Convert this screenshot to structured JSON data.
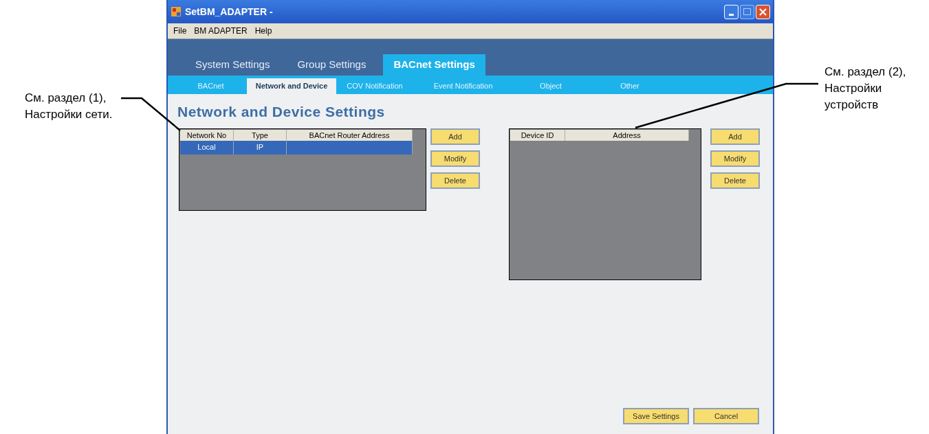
{
  "window": {
    "title": "SetBM_ADAPTER -"
  },
  "menu": [
    "File",
    "BM ADAPTER",
    "Help"
  ],
  "tabs": [
    {
      "label": "System Settings",
      "selected": false
    },
    {
      "label": "Group Settings",
      "selected": false
    },
    {
      "label": "BACnet Settings",
      "selected": true
    }
  ],
  "subtabs": [
    {
      "label": "BACnet",
      "selected": false
    },
    {
      "label": "Network and Device",
      "selected": true
    },
    {
      "label": "COV Notification",
      "selected": false
    },
    {
      "label": "Event Notification",
      "selected": false
    },
    {
      "label": "Object",
      "selected": false
    },
    {
      "label": "Other",
      "selected": false
    }
  ],
  "heading": "Network and Device Settings",
  "network_table": {
    "columns": [
      "Network No",
      "Type",
      "BACnet Router Address"
    ],
    "rows": [
      {
        "cells": [
          "Local",
          "IP",
          ""
        ],
        "selected": true
      }
    ]
  },
  "network_buttons": [
    "Add",
    "Modify",
    "Delete"
  ],
  "device_table": {
    "columns": [
      "Device ID",
      "Address"
    ]
  },
  "device_buttons": [
    "Add",
    "Modify",
    "Delete"
  ],
  "footer_buttons": [
    "Save Settings",
    "Cancel"
  ],
  "callouts": [
    {
      "text": "См. раздел (1),\nНастройки сети."
    },
    {
      "text": "См. раздел (2),\nНастройки\nустройств"
    }
  ]
}
